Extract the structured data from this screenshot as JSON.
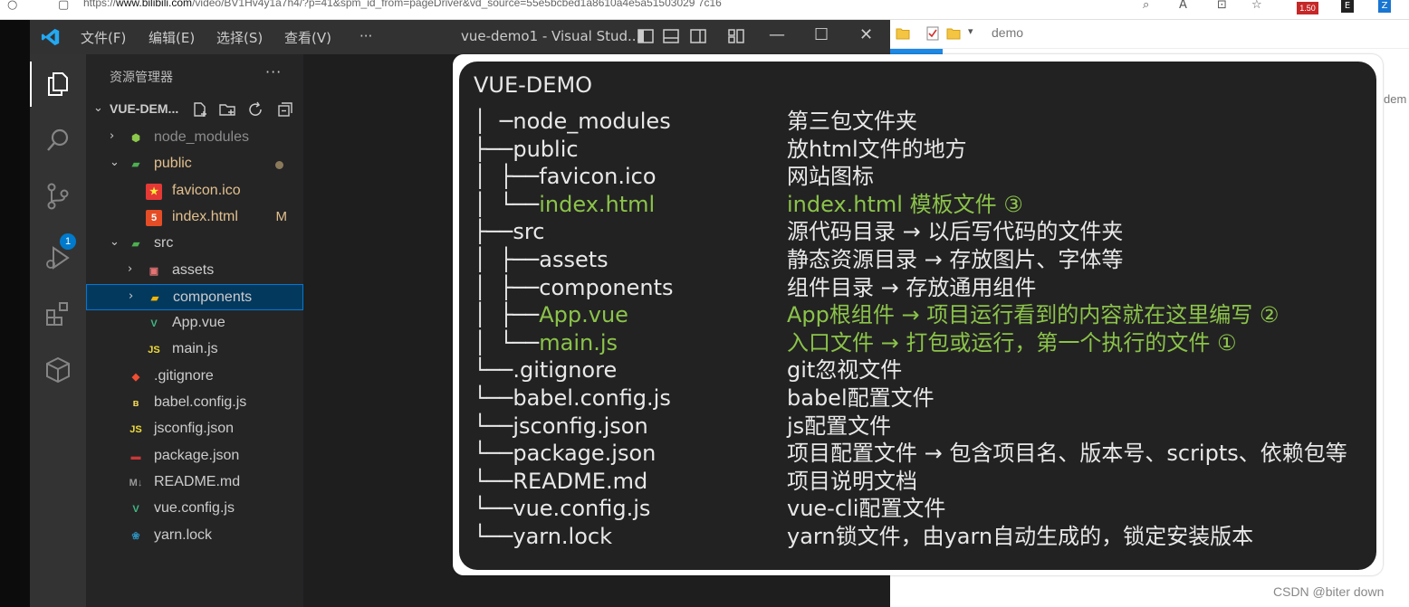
{
  "browser": {
    "url_prefix": "https://",
    "url_domain": "www.bilibili.com",
    "url_rest": "/video/BV1Hv4y1a7h4/?p=41&spm_id_from=pageDriver&vd_source=55e5bcbed1a8610a4e5a51503029 7c16",
    "badge": "1.50"
  },
  "vscode": {
    "menu": [
      "文件(F)",
      "编辑(E)",
      "选择(S)",
      "查看(V)",
      "···"
    ],
    "window_title": "vue-demo1 - Visual Stud...",
    "scm_badge": "1",
    "explorer_title": "资源管理器",
    "explorer_more": "···",
    "project_name": "VUE-DEM...",
    "tree": [
      {
        "name": "node_modules",
        "indent": 1,
        "chev": "›",
        "icon": "node",
        "dim": true
      },
      {
        "name": "public",
        "indent": 1,
        "chev": "⌄",
        "icon": "folder-green",
        "color": "#e2c08d",
        "dot": true
      },
      {
        "name": "favicon.ico",
        "indent": 2,
        "icon": "star",
        "color": "#e2c08d"
      },
      {
        "name": "index.html",
        "indent": 2,
        "icon": "html5",
        "color": "#e2c08d",
        "deco": "M"
      },
      {
        "name": "src",
        "indent": 1,
        "chev": "⌄",
        "icon": "folder-green"
      },
      {
        "name": "assets",
        "indent": 2,
        "chev": "›",
        "icon": "folder-red"
      },
      {
        "name": "components",
        "indent": 2,
        "chev": "›",
        "icon": "folder-yellow",
        "selected": true
      },
      {
        "name": "App.vue",
        "indent": 2,
        "icon": "vue"
      },
      {
        "name": "main.js",
        "indent": 2,
        "icon": "js"
      },
      {
        "name": ".gitignore",
        "indent": 1,
        "icon": "git"
      },
      {
        "name": "babel.config.js",
        "indent": 1,
        "icon": "babel"
      },
      {
        "name": "jsconfig.json",
        "indent": 1,
        "icon": "js"
      },
      {
        "name": "package.json",
        "indent": 1,
        "icon": "npm"
      },
      {
        "name": "README.md",
        "indent": 1,
        "icon": "md"
      },
      {
        "name": "vue.config.js",
        "indent": 1,
        "icon": "vue-config"
      },
      {
        "name": "yarn.lock",
        "indent": 1,
        "icon": "yarn"
      }
    ]
  },
  "right_panel": {
    "toolbar_label": "demo",
    "side_label": "dem"
  },
  "overlay": {
    "title": "VUE-DEMO",
    "rows": [
      {
        "prefix": " │ ─",
        "name": "node_modules",
        "desc": "第三包文件夹"
      },
      {
        "prefix": " ├──",
        "name": "public",
        "desc": "放html文件的地方"
      },
      {
        "prefix": " │  ├──",
        "name": "favicon.ico",
        "desc": "网站图标"
      },
      {
        "prefix": " │  └──",
        "name": "index.html",
        "desc": "index.html 模板文件 ③",
        "highlight": true
      },
      {
        "prefix": " ├──",
        "name": "src",
        "desc": "源代码目录 → 以后写代码的文件夹"
      },
      {
        "prefix": " │  ├──",
        "name": "assets",
        "desc": "静态资源目录 → 存放图片、字体等"
      },
      {
        "prefix": " │  ├──",
        "name": "components",
        "desc": "组件目录 → 存放通用组件"
      },
      {
        "prefix": " │  ├──",
        "name": "App.vue",
        "desc": "App根组件 → 项目运行看到的内容就在这里编写 ②",
        "highlight": true
      },
      {
        "prefix": " │  └──",
        "name": "main.js",
        "desc": "入口文件 → 打包或运行，第一个执行的文件 ①",
        "highlight": true
      },
      {
        "prefix": " └──",
        "name": ".gitignore",
        "desc": "git忽视文件"
      },
      {
        "prefix": " └──",
        "name": "babel.config.js",
        "desc": "babel配置文件"
      },
      {
        "prefix": " └──",
        "name": "jsconfig.json",
        "desc": "js配置文件"
      },
      {
        "prefix": " └──",
        "name": "package.json",
        "desc": "项目配置文件 → 包含项目名、版本号、scripts、依赖包等"
      },
      {
        "prefix": " └──",
        "name": "README.md",
        "desc": "项目说明文档"
      },
      {
        "prefix": " └──",
        "name": "vue.config.js",
        "desc": "vue-cli配置文件"
      },
      {
        "prefix": " └──",
        "name": "yarn.lock",
        "desc": "yarn锁文件，由yarn自动生成的，锁定安装版本"
      }
    ]
  },
  "watermark": "CSDN @biter down",
  "colors": {
    "highlight_green": "#8bc34a",
    "vscode_blue": "#007acc",
    "selection": "#04395e"
  }
}
